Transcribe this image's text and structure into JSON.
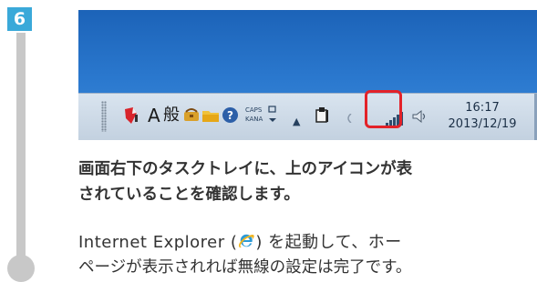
{
  "step": {
    "number": "6",
    "accent": "#3aa9d9",
    "rail_color": "#c8c8c8"
  },
  "screenshot": {
    "tray": {
      "lang": "A",
      "ime_mode": "般",
      "caps": "CAPS",
      "kana": "KANA",
      "show_hidden": "▲",
      "highlight_color": "#e32229"
    },
    "clock": {
      "time": "16:17",
      "date": "2013/12/19"
    }
  },
  "text": {
    "line1": "画面右下のタスクトレイに、上のアイコンが表",
    "line2": "されていることを確認します。",
    "line3_before": "Internet Explorer (",
    "line3_after": ") を起動して、ホー",
    "line4": "ページが表示されれば無線の設定は完了です。"
  },
  "icons": [
    "red-shield-icon",
    "toolbox-icon",
    "folder-icon",
    "help-icon",
    "action-center-icon",
    "wireless-signal-icon",
    "speaker-icon",
    "internet-explorer-icon"
  ]
}
